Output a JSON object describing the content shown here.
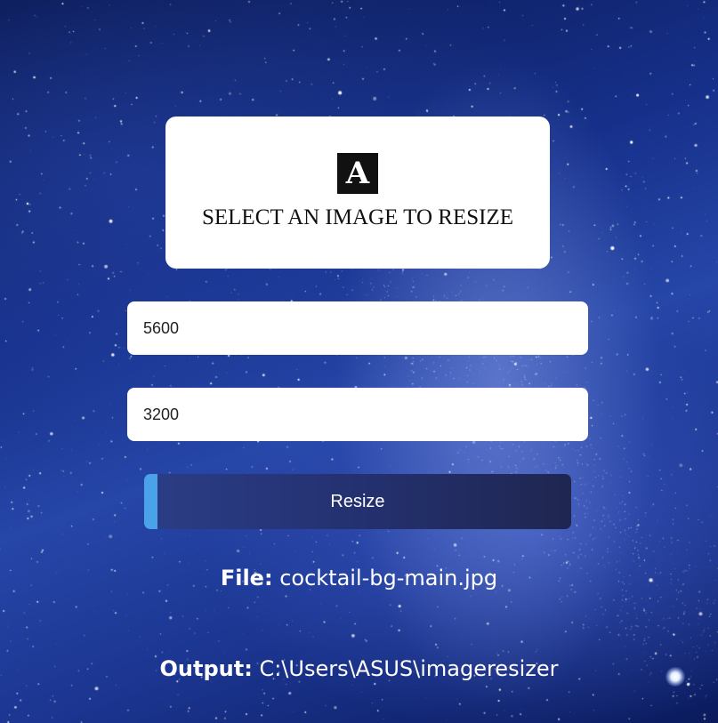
{
  "dropzone": {
    "icon_glyph": "A",
    "icon_name": "letter-a-icon",
    "label": "SELECT AN IMAGE TO RESIZE"
  },
  "inputs": {
    "width_value": "5600",
    "height_value": "3200"
  },
  "resize_button": {
    "label": "Resize"
  },
  "file": {
    "key": "File:",
    "value": "cocktail-bg-main.jpg"
  },
  "output": {
    "key": "Output:",
    "value": "C:\\Users\\ASUS\\imageresizer"
  },
  "colors": {
    "button_accent": "#4aa2e8",
    "button_bg": "#243170",
    "card_bg": "#ffffff",
    "text_light": "#ffffff"
  }
}
